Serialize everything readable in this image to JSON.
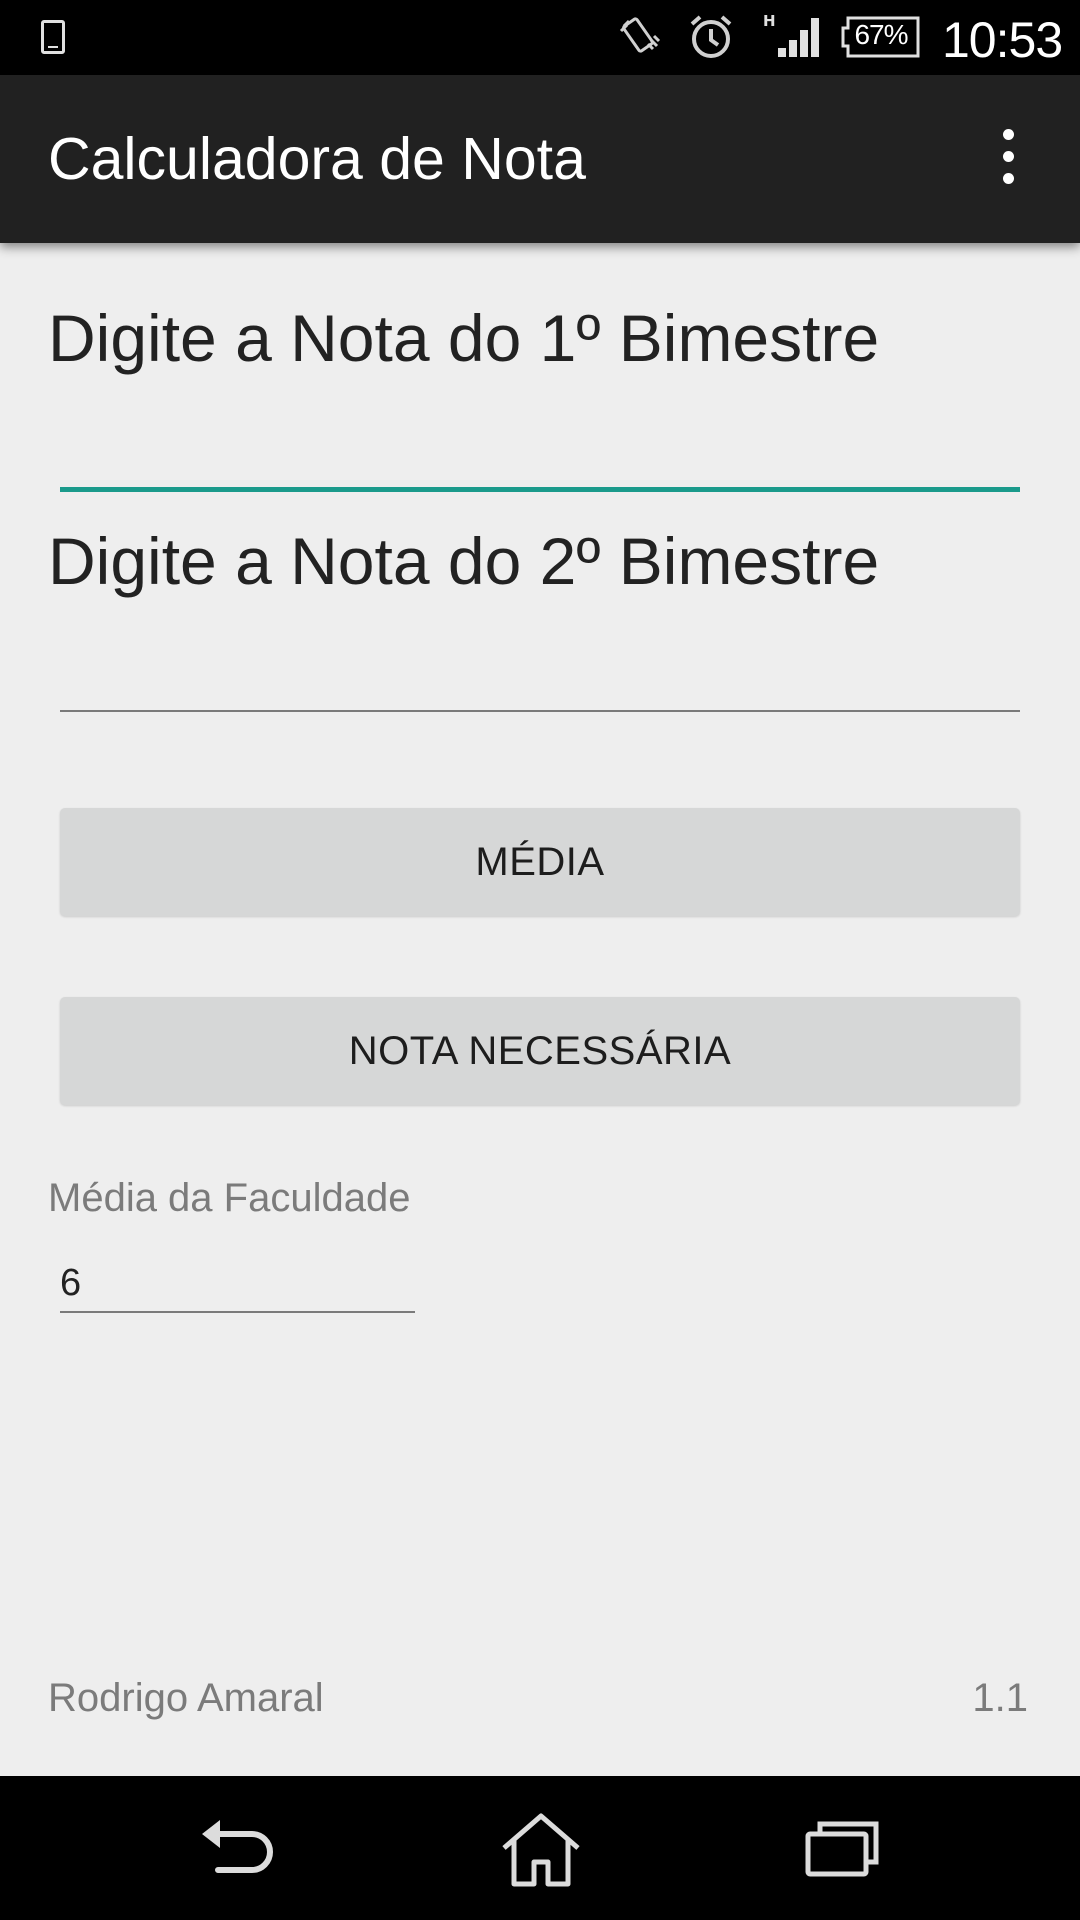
{
  "status_bar": {
    "icons": [
      "sim-card-icon",
      "vibrate-icon",
      "alarm-icon",
      "signal-icon",
      "battery-icon"
    ],
    "network_type": "H",
    "battery": "67%",
    "time": "10:53"
  },
  "app_bar": {
    "title": "Calculadora de Nota",
    "overflow_icon": "more-vert-icon"
  },
  "form": {
    "grade1_label": "Digite a Nota do 1º Bimestre",
    "grade1_value": "",
    "grade2_label": "Digite a Nota do 2º Bimestre",
    "grade2_value": "",
    "average_button": "MÉDIA",
    "needed_button": "NOTA NECESSÁRIA",
    "faculty_avg_label": "Média da Faculdade",
    "faculty_avg_value": "6"
  },
  "footer": {
    "author": "Rodrigo Amaral",
    "version": "1.1"
  },
  "nav_bar": {
    "icons": [
      "back-icon",
      "home-icon",
      "recent-apps-icon"
    ]
  },
  "colors": {
    "app_bar": "#212121",
    "accent": "#1a9a8b",
    "background": "#eeeeee",
    "button": "#d6d7d7"
  }
}
